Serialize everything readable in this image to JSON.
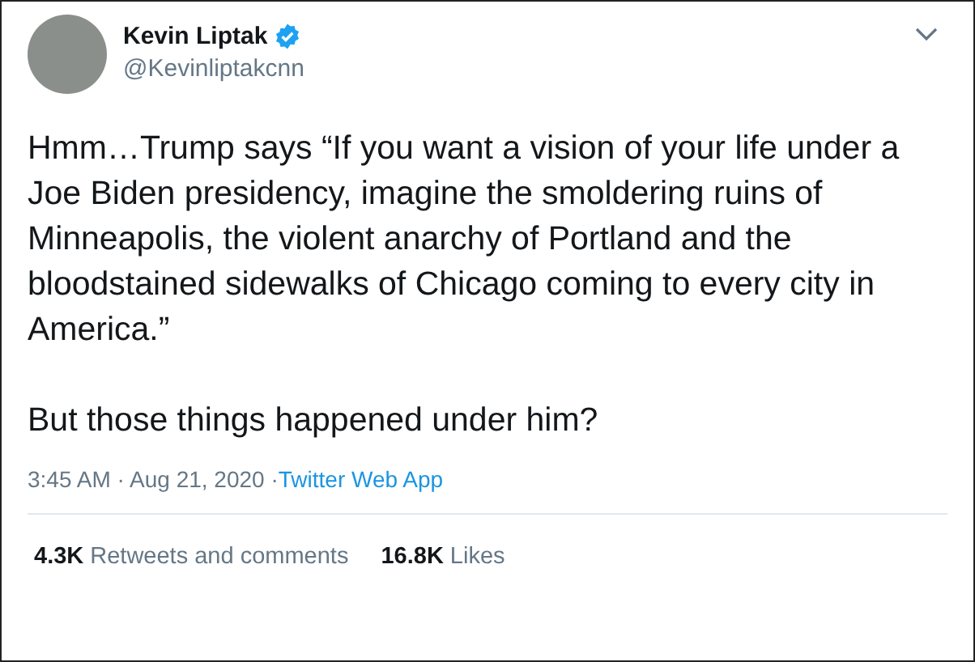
{
  "author": {
    "name": "Kevin Liptak",
    "verified": true,
    "handle": "@Kevinliptakcnn"
  },
  "tweet": {
    "paragraphs": [
      "Hmm…Trump says “If you want a vision of your life under a Joe Biden presidency, imagine the smoldering ruins of Minneapolis, the violent anarchy of Portland and the bloodstained sidewalks of Chicago coming to every city in America.”",
      "But those things happened under him?"
    ]
  },
  "meta": {
    "timestamp": "3:45 AM · Aug 21, 2020 · ",
    "source": "Twitter Web App"
  },
  "stats": [
    {
      "count": "4.3K",
      "label": "Retweets and comments"
    },
    {
      "count": "16.8K",
      "label": "Likes"
    }
  ]
}
